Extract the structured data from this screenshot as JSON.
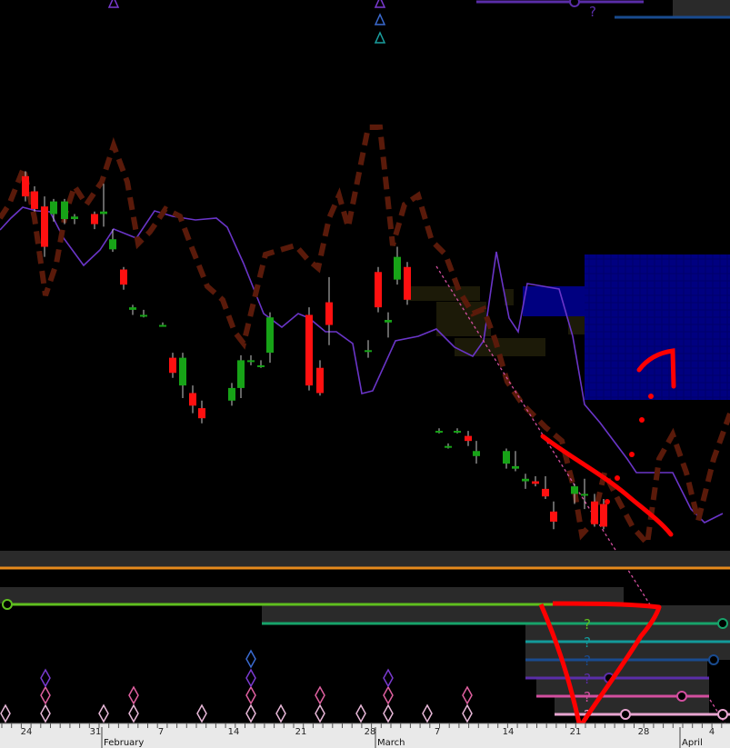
{
  "chart_data": {
    "type": "candlestick",
    "x_axis": {
      "day_ticks": [
        "24",
        "31",
        "7",
        "14",
        "21",
        "28",
        "7",
        "14",
        "21",
        "28",
        "4"
      ],
      "month_labels": [
        "February",
        "March",
        "April"
      ]
    },
    "price_scale": {
      "note": "no y-axis labels visible",
      "ylim": [
        0,
        100
      ]
    },
    "candles": [
      {
        "o": 60,
        "h": 62,
        "l": 50,
        "c": 52
      },
      {
        "o": 54,
        "h": 56,
        "l": 46,
        "c": 47
      },
      {
        "o": 48,
        "h": 52,
        "l": 28,
        "c": 32
      },
      {
        "o": 45,
        "h": 51,
        "l": 42,
        "c": 50
      },
      {
        "o": 43,
        "h": 51,
        "l": 41,
        "c": 50
      },
      {
        "o": 43,
        "h": 45,
        "l": 41,
        "c": 44
      },
      {
        "o": 45,
        "h": 46,
        "l": 39,
        "c": 41
      },
      {
        "o": 45,
        "h": 57,
        "l": 40,
        "c": 46
      },
      {
        "o": 31,
        "h": 39,
        "l": 30,
        "c": 35
      },
      {
        "o": 23,
        "h": 24,
        "l": 15,
        "c": 17
      },
      {
        "o": 7,
        "h": 9,
        "l": 5,
        "c": 8
      },
      {
        "o": 5,
        "h": 7,
        "l": 4,
        "c": 5
      },
      {
        "o": 1,
        "h": 2,
        "l": 1,
        "c": 1
      },
      {
        "o": -12,
        "h": -10,
        "l": -20,
        "c": -18
      },
      {
        "o": -23,
        "h": -10,
        "l": -28,
        "c": -12
      },
      {
        "o": -26,
        "h": -23,
        "l": -34,
        "c": -31
      },
      {
        "o": -32,
        "h": -29,
        "l": -38,
        "c": -36
      },
      {
        "o": -29,
        "h": -22,
        "l": -31,
        "c": -24
      },
      {
        "o": -24,
        "h": -11,
        "l": -28,
        "c": -13
      },
      {
        "o": -13,
        "h": -11,
        "l": -15,
        "c": -13
      },
      {
        "o": -15,
        "h": -13,
        "l": -16,
        "c": -15
      },
      {
        "o": -10,
        "h": 6,
        "l": -14,
        "c": 4
      },
      {
        "o": 5,
        "h": 8,
        "l": -25,
        "c": -23
      },
      {
        "o": -16,
        "h": -13,
        "l": -27,
        "c": -26
      },
      {
        "o": 10,
        "h": 20,
        "l": -7,
        "c": 1
      },
      {
        "o": -9,
        "h": -5,
        "l": -12,
        "c": -9
      },
      {
        "o": 2,
        "h": 6,
        "l": -4,
        "c": 3
      },
      {
        "o": 19,
        "h": 32,
        "l": 17,
        "c": 28
      },
      {
        "o": 22,
        "h": 24,
        "l": 6,
        "c": 8
      },
      {
        "o": 24,
        "h": 26,
        "l": 9,
        "c": 11
      },
      {
        "o": -41,
        "h": -40,
        "l": -42,
        "c": -41
      },
      {
        "o": -47,
        "h": -46,
        "l": -48,
        "c": -47
      },
      {
        "o": -41,
        "h": -40,
        "l": -42,
        "c": -41
      },
      {
        "o": -43,
        "h": -41,
        "l": -47,
        "c": -45
      },
      {
        "o": -51,
        "h": -45,
        "l": -54,
        "c": -49
      },
      {
        "o": -54,
        "h": -48,
        "l": -56,
        "c": -49
      },
      {
        "o": -56,
        "h": -49,
        "l": -57,
        "c": -55
      },
      {
        "o": -61,
        "h": -58,
        "l": -64,
        "c": -60
      },
      {
        "o": -61,
        "h": -59,
        "l": -63,
        "c": -62
      },
      {
        "o": -64,
        "h": -59,
        "l": -68,
        "c": -67
      },
      {
        "o": -66,
        "h": -62,
        "l": -70,
        "c": -63
      },
      {
        "o": -66,
        "h": -60,
        "l": -72,
        "c": -66
      },
      {
        "o": -69,
        "h": -66,
        "l": -79,
        "c": -78
      },
      {
        "o": -70,
        "h": -68,
        "l": -80,
        "c": -79
      },
      {
        "o": -73,
        "h": -69,
        "l": -80,
        "c": -77
      }
    ],
    "series": [
      {
        "name": "",
        "color": "#6a35c8"
      },
      {
        "name": "",
        "color": "#5a1a0a"
      }
    ],
    "colors": {
      "up": "#17a317",
      "down": "#ff1010",
      "purple_line": "#6a35c8",
      "brown_dashed": "#5a1a0a",
      "navy_block": "#000080",
      "orange_line": "#e68a1c",
      "green_line": "#5fbf1f",
      "teal_line": "#139a9a",
      "blue_line": "#194b8f",
      "violet_line": "#5a2da8",
      "pink_line": "#d34f9f",
      "lightpink_line": "#e8a5d0",
      "annotation": "#ff0000"
    },
    "overlay_glyphs": {
      "question_mark": "?"
    },
    "chart_type_note": "candlestick with overlays"
  }
}
